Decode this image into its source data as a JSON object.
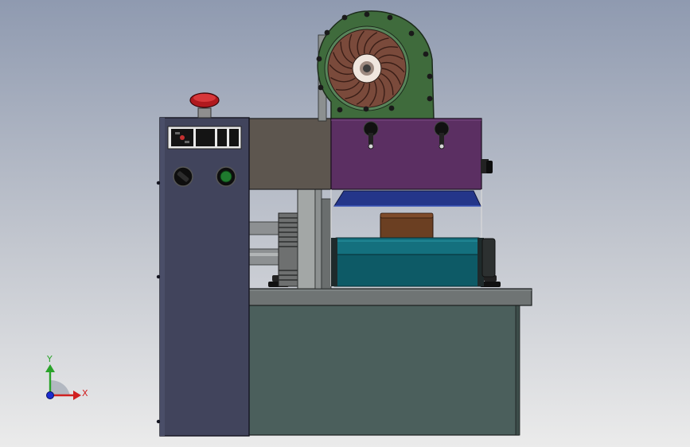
{
  "viewport": {
    "background_top": "#8f9ab0",
    "background_bottom": "#ebebeb"
  },
  "colors": {
    "control_cabinet": "#41445c",
    "base_cabinet": "#4b5f5c",
    "worktop": "#6f7474",
    "tan_housing": "#5d564f",
    "heater_box": "#5b2f62",
    "blue_hood": "#24368a",
    "teal_belt": "#0d5a66",
    "brown_block": "#6b3f22",
    "blower_body": "#3f6b3c",
    "blower_wheel": "#7a4a3b",
    "estop_red": "#b0191e",
    "green_button": "#1f7a2e"
  },
  "triad": {
    "y_label": "Y",
    "x_label": "X",
    "y_color": "#2aa32a",
    "x_color": "#d02020",
    "z_color": "#1a2bd0"
  }
}
